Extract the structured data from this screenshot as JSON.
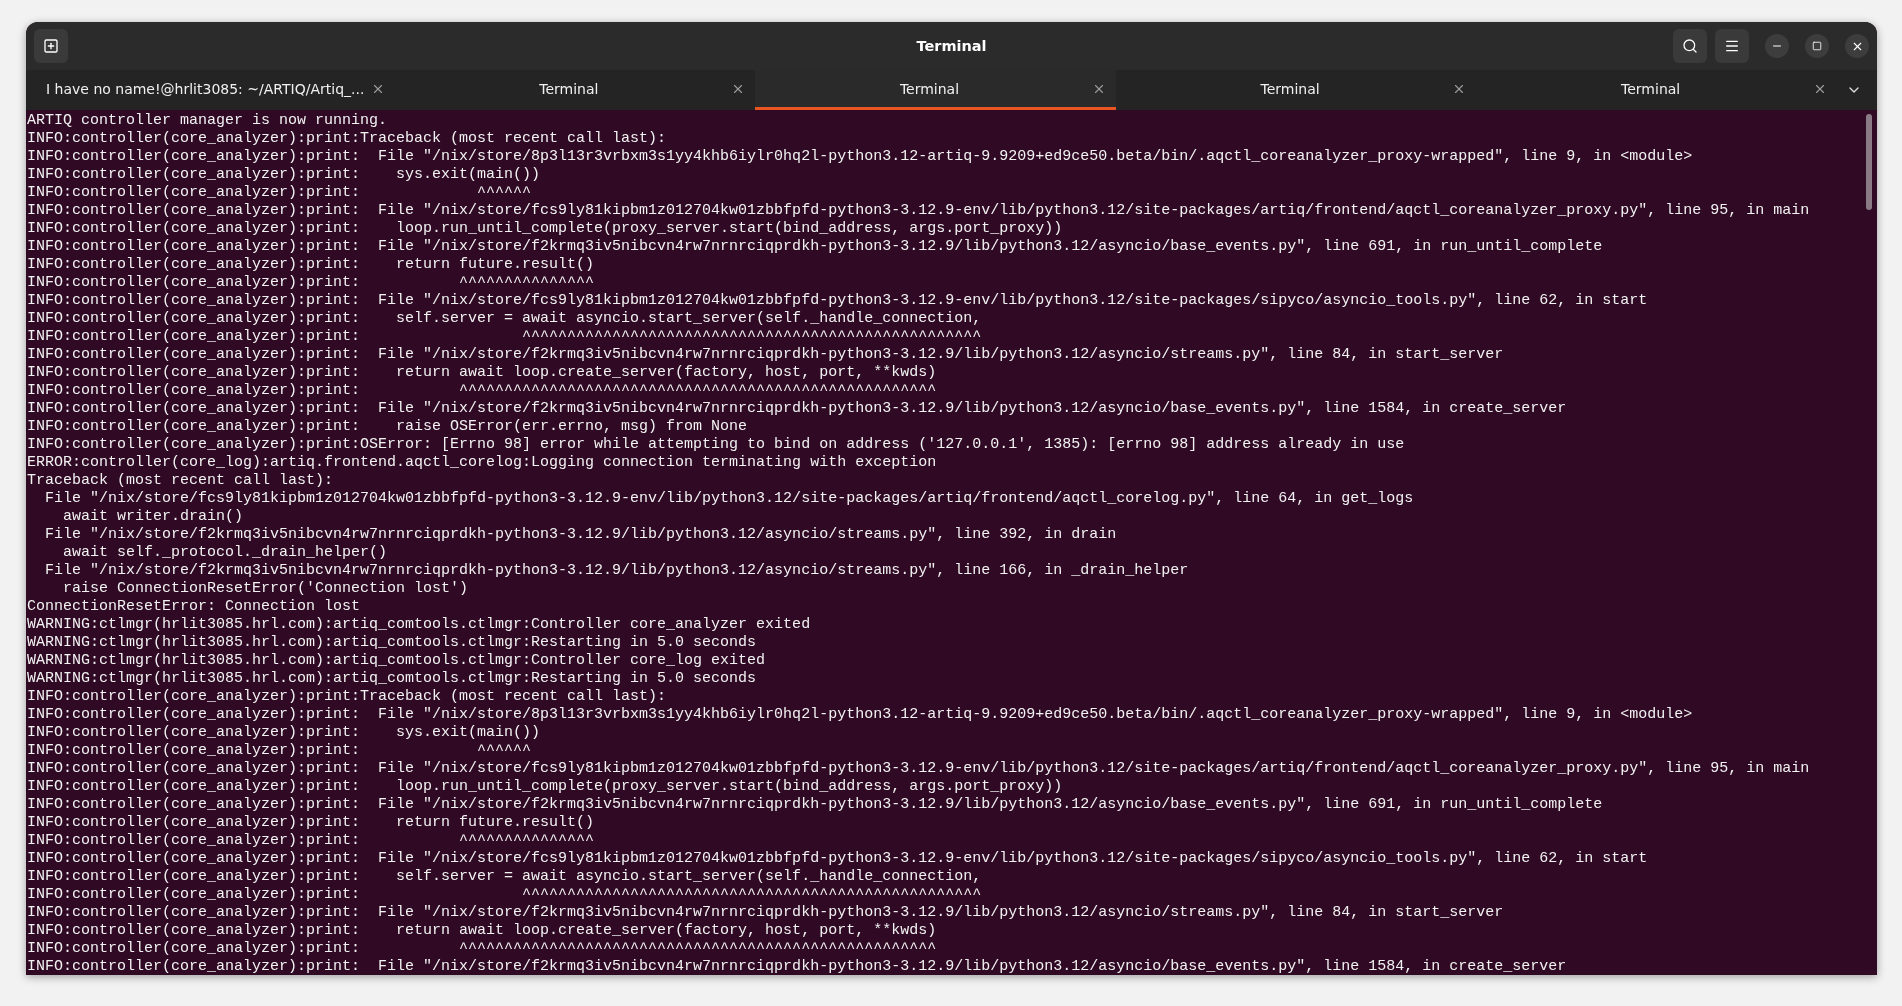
{
  "window": {
    "title": "Terminal"
  },
  "tabs": [
    {
      "label": "I have no name!@hrlit3085: ~/ARTIQ/Artiq_...",
      "selected": false
    },
    {
      "label": "Terminal",
      "selected": false
    },
    {
      "label": "Terminal",
      "selected": true
    },
    {
      "label": "Terminal",
      "selected": false
    },
    {
      "label": "Terminal",
      "selected": false
    }
  ],
  "terminal": {
    "lines": [
      "ARTIQ controller manager is now running.",
      "INFO:controller(core_analyzer):print:Traceback (most recent call last):",
      "INFO:controller(core_analyzer):print:  File \"/nix/store/8p3l13r3vrbxm3s1yy4khb6iylr0hq2l-python3.12-artiq-9.9209+ed9ce50.beta/bin/.aqctl_coreanalyzer_proxy-wrapped\", line 9, in <module>",
      "INFO:controller(core_analyzer):print:    sys.exit(main())",
      "INFO:controller(core_analyzer):print:             ^^^^^^",
      "INFO:controller(core_analyzer):print:  File \"/nix/store/fcs9ly81kipbm1z012704kw01zbbfpfd-python3-3.12.9-env/lib/python3.12/site-packages/artiq/frontend/aqctl_coreanalyzer_proxy.py\", line 95, in main",
      "INFO:controller(core_analyzer):print:    loop.run_until_complete(proxy_server.start(bind_address, args.port_proxy))",
      "INFO:controller(core_analyzer):print:  File \"/nix/store/f2krmq3iv5nibcvn4rw7nrnrciqprdkh-python3-3.12.9/lib/python3.12/asyncio/base_events.py\", line 691, in run_until_complete",
      "INFO:controller(core_analyzer):print:    return future.result()",
      "INFO:controller(core_analyzer):print:           ^^^^^^^^^^^^^^^",
      "INFO:controller(core_analyzer):print:  File \"/nix/store/fcs9ly81kipbm1z012704kw01zbbfpfd-python3-3.12.9-env/lib/python3.12/site-packages/sipyco/asyncio_tools.py\", line 62, in start",
      "INFO:controller(core_analyzer):print:    self.server = await asyncio.start_server(self._handle_connection,",
      "INFO:controller(core_analyzer):print:                  ^^^^^^^^^^^^^^^^^^^^^^^^^^^^^^^^^^^^^^^^^^^^^^^^^^^",
      "INFO:controller(core_analyzer):print:  File \"/nix/store/f2krmq3iv5nibcvn4rw7nrnrciqprdkh-python3-3.12.9/lib/python3.12/asyncio/streams.py\", line 84, in start_server",
      "INFO:controller(core_analyzer):print:    return await loop.create_server(factory, host, port, **kwds)",
      "INFO:controller(core_analyzer):print:           ^^^^^^^^^^^^^^^^^^^^^^^^^^^^^^^^^^^^^^^^^^^^^^^^^^^^^",
      "INFO:controller(core_analyzer):print:  File \"/nix/store/f2krmq3iv5nibcvn4rw7nrnrciqprdkh-python3-3.12.9/lib/python3.12/asyncio/base_events.py\", line 1584, in create_server",
      "INFO:controller(core_analyzer):print:    raise OSError(err.errno, msg) from None",
      "INFO:controller(core_analyzer):print:OSError: [Errno 98] error while attempting to bind on address ('127.0.0.1', 1385): [errno 98] address already in use",
      "ERROR:controller(core_log):artiq.frontend.aqctl_corelog:Logging connection terminating with exception",
      "Traceback (most recent call last):",
      "  File \"/nix/store/fcs9ly81kipbm1z012704kw01zbbfpfd-python3-3.12.9-env/lib/python3.12/site-packages/artiq/frontend/aqctl_corelog.py\", line 64, in get_logs",
      "    await writer.drain()",
      "  File \"/nix/store/f2krmq3iv5nibcvn4rw7nrnrciqprdkh-python3-3.12.9/lib/python3.12/asyncio/streams.py\", line 392, in drain",
      "    await self._protocol._drain_helper()",
      "  File \"/nix/store/f2krmq3iv5nibcvn4rw7nrnrciqprdkh-python3-3.12.9/lib/python3.12/asyncio/streams.py\", line 166, in _drain_helper",
      "    raise ConnectionResetError('Connection lost')",
      "ConnectionResetError: Connection lost",
      "WARNING:ctlmgr(hrlit3085.hrl.com):artiq_comtools.ctlmgr:Controller core_analyzer exited",
      "WARNING:ctlmgr(hrlit3085.hrl.com):artiq_comtools.ctlmgr:Restarting in 5.0 seconds",
      "WARNING:ctlmgr(hrlit3085.hrl.com):artiq_comtools.ctlmgr:Controller core_log exited",
      "WARNING:ctlmgr(hrlit3085.hrl.com):artiq_comtools.ctlmgr:Restarting in 5.0 seconds",
      "INFO:controller(core_analyzer):print:Traceback (most recent call last):",
      "INFO:controller(core_analyzer):print:  File \"/nix/store/8p3l13r3vrbxm3s1yy4khb6iylr0hq2l-python3.12-artiq-9.9209+ed9ce50.beta/bin/.aqctl_coreanalyzer_proxy-wrapped\", line 9, in <module>",
      "INFO:controller(core_analyzer):print:    sys.exit(main())",
      "INFO:controller(core_analyzer):print:             ^^^^^^",
      "INFO:controller(core_analyzer):print:  File \"/nix/store/fcs9ly81kipbm1z012704kw01zbbfpfd-python3-3.12.9-env/lib/python3.12/site-packages/artiq/frontend/aqctl_coreanalyzer_proxy.py\", line 95, in main",
      "INFO:controller(core_analyzer):print:    loop.run_until_complete(proxy_server.start(bind_address, args.port_proxy))",
      "INFO:controller(core_analyzer):print:  File \"/nix/store/f2krmq3iv5nibcvn4rw7nrnrciqprdkh-python3-3.12.9/lib/python3.12/asyncio/base_events.py\", line 691, in run_until_complete",
      "INFO:controller(core_analyzer):print:    return future.result()",
      "INFO:controller(core_analyzer):print:           ^^^^^^^^^^^^^^^",
      "INFO:controller(core_analyzer):print:  File \"/nix/store/fcs9ly81kipbm1z012704kw01zbbfpfd-python3-3.12.9-env/lib/python3.12/site-packages/sipyco/asyncio_tools.py\", line 62, in start",
      "INFO:controller(core_analyzer):print:    self.server = await asyncio.start_server(self._handle_connection,",
      "INFO:controller(core_analyzer):print:                  ^^^^^^^^^^^^^^^^^^^^^^^^^^^^^^^^^^^^^^^^^^^^^^^^^^^",
      "INFO:controller(core_analyzer):print:  File \"/nix/store/f2krmq3iv5nibcvn4rw7nrnrciqprdkh-python3-3.12.9/lib/python3.12/asyncio/streams.py\", line 84, in start_server",
      "INFO:controller(core_analyzer):print:    return await loop.create_server(factory, host, port, **kwds)",
      "INFO:controller(core_analyzer):print:           ^^^^^^^^^^^^^^^^^^^^^^^^^^^^^^^^^^^^^^^^^^^^^^^^^^^^^",
      "INFO:controller(core_analyzer):print:  File \"/nix/store/f2krmq3iv5nibcvn4rw7nrnrciqprdkh-python3-3.12.9/lib/python3.12/asyncio/base_events.py\", line 1584, in create_server"
    ]
  }
}
